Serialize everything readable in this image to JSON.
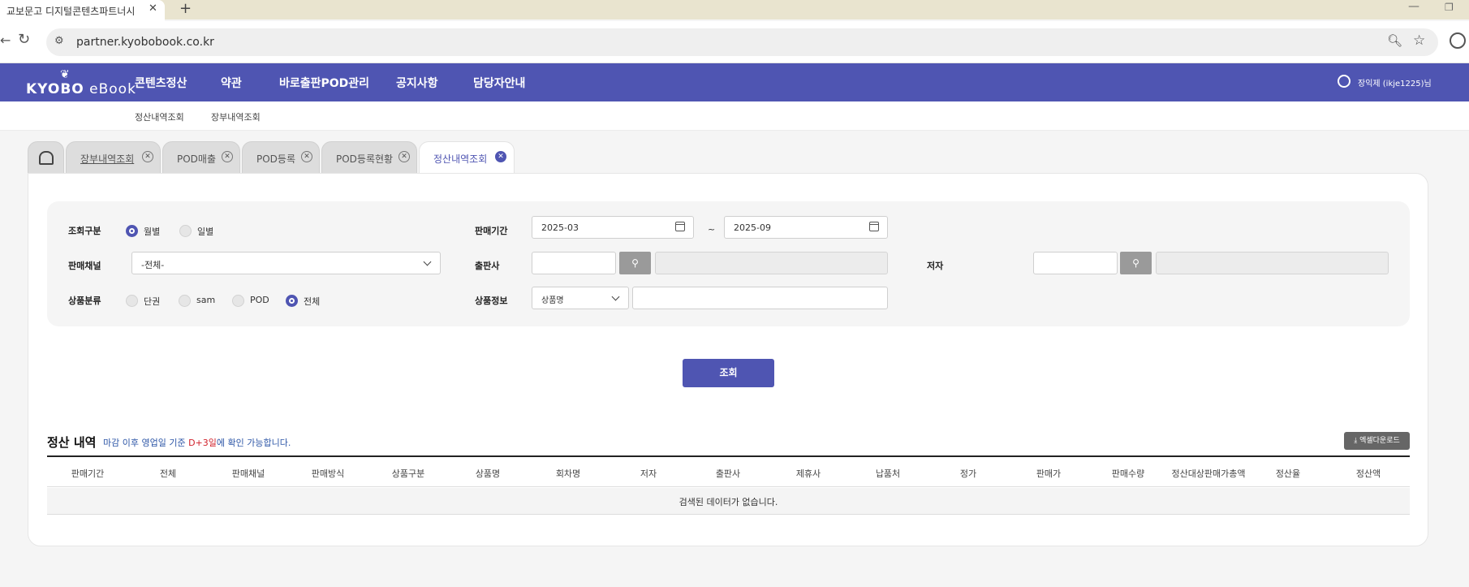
{
  "browser": {
    "tab_title": "교보문고 디지털콘텐츠파트너시",
    "tab_close": "✕",
    "new_tab": "+",
    "url": "partner.kyobobook.co.kr"
  },
  "header": {
    "logo_kyobo": "KYOBO",
    "logo_ebook": "eBook",
    "nav": [
      "콘텐츠정산",
      "약관",
      "바로출판POD관리",
      "공지사항",
      "담당자안내"
    ],
    "user": "장익제 (ikje1225)님"
  },
  "subnav": [
    "정산내역조회",
    "장부내역조회"
  ],
  "tabs": [
    {
      "label": "장부내역조회"
    },
    {
      "label": "POD매출"
    },
    {
      "label": "POD등록"
    },
    {
      "label": "POD등록현황"
    },
    {
      "label": "정산내역조회",
      "active": true
    }
  ],
  "search": {
    "type_label": "조회구분",
    "type_options": [
      {
        "label": "월별",
        "checked": true
      },
      {
        "label": "일별",
        "checked": false
      }
    ],
    "period_label": "판매기간",
    "period_from": "2025-03",
    "period_sep": "~",
    "period_to": "2025-09",
    "channel_label": "판매채널",
    "channel_value": "-전체-",
    "publisher_label": "출판사",
    "author_label": "저자",
    "category_label": "상품분류",
    "category_options": [
      {
        "label": "단권",
        "checked": false
      },
      {
        "label": "sam",
        "checked": false
      },
      {
        "label": "POD",
        "checked": false
      },
      {
        "label": "전체",
        "checked": true
      }
    ],
    "product_label": "상품정보",
    "product_select": "상품명",
    "submit": "조회"
  },
  "result": {
    "title": "정산 내역",
    "notice_pre": "마감 이후 영업일 기준 ",
    "notice_red": "D+3일",
    "notice_post": "에 확인 가능합니다.",
    "excel": "⤓ 엑셀다운로드",
    "columns": [
      "판매기간",
      "전체",
      "판매채널",
      "판매방식",
      "상품구분",
      "상품명",
      "회차명",
      "저자",
      "출판사",
      "제휴사",
      "납품처",
      "정가",
      "판매가",
      "판매수량",
      "정산대상판매가총액",
      "정산율",
      "정산액"
    ],
    "empty": "검색된 데이터가 없습니다."
  },
  "colors": {
    "brand": "#4f55b2",
    "notice": "#2d56a7",
    "notice_red": "#d0202a"
  }
}
